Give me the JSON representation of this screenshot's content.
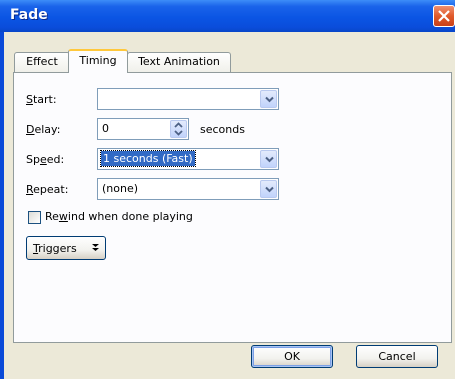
{
  "window": {
    "title": "Fade"
  },
  "tabs": [
    {
      "label": "Effect",
      "active": false
    },
    {
      "label": "Timing",
      "active": true
    },
    {
      "label": "Text Animation",
      "active": false
    }
  ],
  "fields": {
    "start": {
      "label_pre": "",
      "label_key": "S",
      "label_post": "tart:",
      "value": ""
    },
    "delay": {
      "label_pre": "",
      "label_key": "D",
      "label_post": "elay:",
      "value": "0",
      "unit": "seconds"
    },
    "speed": {
      "label_pre": "Sp",
      "label_key": "e",
      "label_post": "ed:",
      "value": "1 seconds (Fast)"
    },
    "repeat": {
      "label_pre": "",
      "label_key": "R",
      "label_post": "epeat:",
      "value": "(none)"
    }
  },
  "rewind": {
    "label_pre": "Re",
    "label_key": "w",
    "label_post": "ind when done playing",
    "checked": false
  },
  "triggers_button": {
    "label_pre": "",
    "label_key": "T",
    "label_post": "riggers"
  },
  "buttons": {
    "ok": "OK",
    "cancel": "Cancel"
  },
  "colors": {
    "titlebar": "#0a4ad8",
    "dialog_face": "#ece9d8",
    "selection": "#316ac5",
    "active_tab_accent": "#ffc83c"
  }
}
